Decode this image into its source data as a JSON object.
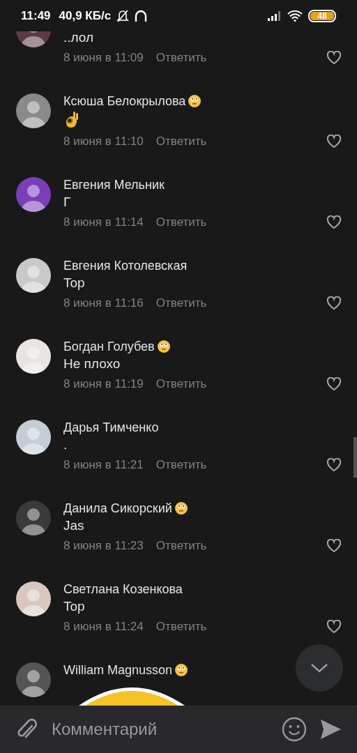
{
  "status_bar": {
    "time": "11:49",
    "speed": "40,9 КБ/с",
    "battery": "48"
  },
  "comments": [
    {
      "color": "#5a3a44",
      "body": {
        "kind": "text",
        "text": "..лол"
      },
      "date": "8 июня в 11:09",
      "reply": "Ответить",
      "liked": false
    },
    {
      "author": "Ксюша Белокрылова",
      "author_badge": true,
      "color": "#8a8a8a",
      "body": {
        "kind": "emoji"
      },
      "date": "8 июня в 11:10",
      "reply": "Ответить",
      "liked": false
    },
    {
      "author": "Евгения Мельник",
      "author_badge": false,
      "color": "#7a3fb8",
      "body": {
        "kind": "text",
        "text": "Г"
      },
      "date": "8 июня в 11:14",
      "reply": "Ответить",
      "liked": false
    },
    {
      "author": "Евгения Котолевская",
      "author_badge": false,
      "color": "#c9c9c9",
      "body": {
        "kind": "text",
        "text": "Top"
      },
      "date": "8 июня в 11:16",
      "reply": "Ответить",
      "liked": false
    },
    {
      "author": "Богдан Голубев",
      "author_badge": true,
      "color": "#e8e4e0",
      "body": {
        "kind": "text",
        "text": "Не плохо"
      },
      "date": "8 июня в 11:19",
      "reply": "Ответить",
      "liked": false
    },
    {
      "author": "Дарья Тимченко",
      "author_badge": false,
      "color": "#c4ccd6",
      "body": {
        "kind": "text",
        "text": "."
      },
      "date": "8 июня в 11:21",
      "reply": "Ответить",
      "liked": false
    },
    {
      "author": "Данила Сикорский",
      "author_badge": true,
      "color": "#3a3a3a",
      "body": {
        "kind": "text",
        "text": "Jas"
      },
      "date": "8 июня в 11:23",
      "reply": "Ответить",
      "liked": false
    },
    {
      "author": "Светлана Козенкова",
      "author_badge": false,
      "color": "#d8c8c0",
      "body": {
        "kind": "text",
        "text": "Top"
      },
      "date": "8 июня в 11:24",
      "reply": "Ответить",
      "liked": false
    },
    {
      "author": "William Magnusson",
      "author_badge": true,
      "color": "#555555",
      "body": {
        "kind": "sticker"
      }
    }
  ],
  "composer": {
    "placeholder": "Комментарий"
  }
}
